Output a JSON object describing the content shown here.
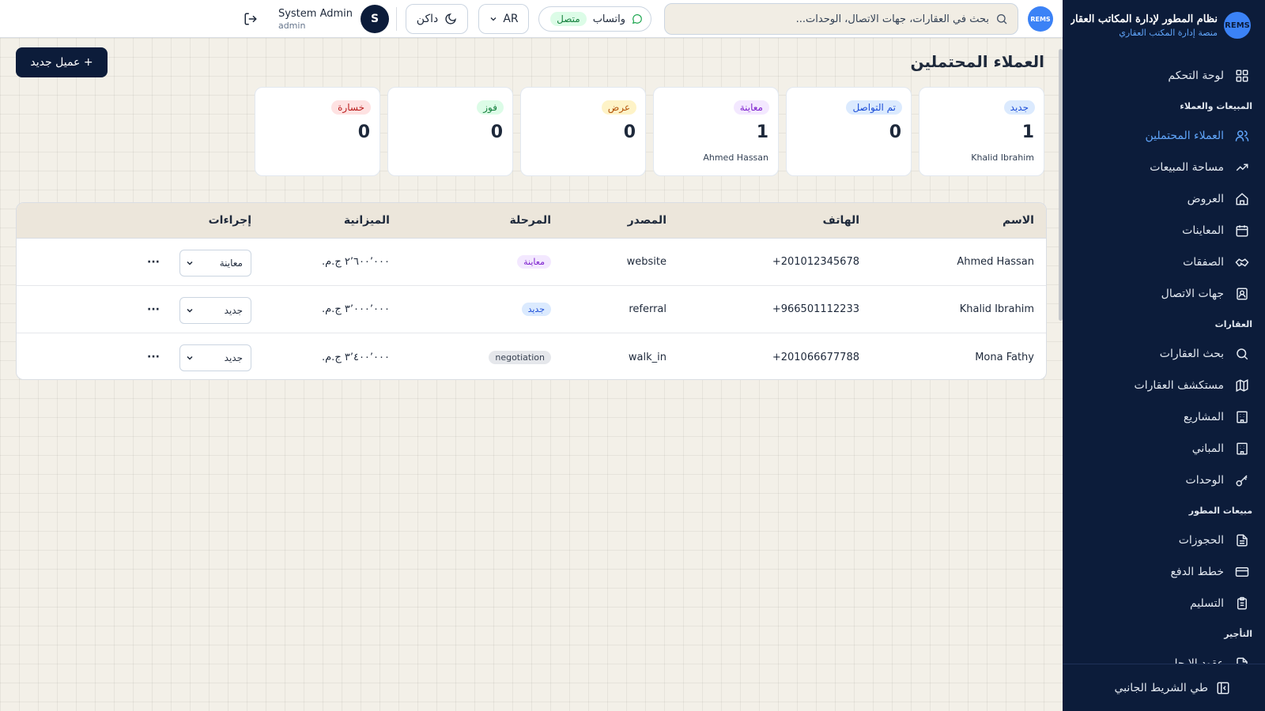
{
  "brand": {
    "logo_text": "REMS",
    "title": "نظام المطور لإدارة المكاتب العقارية",
    "subtitle": "منصة إدارة المكتب العقاري"
  },
  "sidebar": {
    "dashboard": "لوحة التحكم",
    "section_sales": "المبيعات والعملاء",
    "leads": "العملاء المحتملين",
    "sales_space": "مساحة المبيعات",
    "offers": "العروض",
    "viewings": "المعاينات",
    "deals": "الصفقات",
    "contacts": "جهات الاتصال",
    "section_properties": "العقارات",
    "property_search": "بحث العقارات",
    "property_explorer": "مستكشف العقارات",
    "projects": "المشاريع",
    "buildings": "المباني",
    "units": "الوحدات",
    "section_developer": "مبيعات المطور",
    "bookings": "الحجوزات",
    "payment_plans": "خطط الدفع",
    "handover": "التسليم",
    "section_rental": "التأجير",
    "leases": "عقود الإيجار",
    "collapse": "طي الشريط الجانبي"
  },
  "topbar": {
    "avatar_text": "REMS",
    "search_placeholder": "بحث في العقارات، جهات الاتصال، الوحدات...",
    "whatsapp_label": "واتساب",
    "whatsapp_status": "متصل",
    "language": "AR",
    "theme": "داكن",
    "user_initial": "S",
    "user_name": "System Admin",
    "user_role": "admin"
  },
  "page": {
    "title": "العملاء المحتملين",
    "add_button": "+ عميل جديد"
  },
  "colors": {
    "sidebar_bg": "#0c1c3a",
    "accent": "#3b82f6",
    "primary_button": "#0c1c3a"
  },
  "stages": [
    {
      "label": "جديد",
      "count": "1",
      "names": "Khalid Ibrahim",
      "bg": "#dbeafe",
      "fg": "#1d4ed8"
    },
    {
      "label": "تم التواصل",
      "count": "0",
      "names": "",
      "bg": "#dbeafe",
      "fg": "#1d4ed8"
    },
    {
      "label": "معاينة",
      "count": "1",
      "names": "Ahmed Hassan",
      "bg": "#f3e8ff",
      "fg": "#7e22ce"
    },
    {
      "label": "عرض",
      "count": "0",
      "names": "",
      "bg": "#fef3c7",
      "fg": "#b45309"
    },
    {
      "label": "فوز",
      "count": "0",
      "names": "",
      "bg": "#dcfce7",
      "fg": "#15803d"
    },
    {
      "label": "خسارة",
      "count": "0",
      "names": "",
      "bg": "#fee2e2",
      "fg": "#b91c1c"
    }
  ],
  "table": {
    "headers": {
      "name": "الاسم",
      "phone": "الهاتف",
      "source": "المصدر",
      "stage": "المرحلة",
      "budget": "الميزانية",
      "actions": "إجراءات"
    },
    "rows": [
      {
        "name": "Ahmed Hassan",
        "phone": "+201012345678",
        "source": "website",
        "stage": "معاينة",
        "stage_bg": "#f3e8ff",
        "stage_fg": "#7e22ce",
        "budget": "٢٬٦٠٠٬٠٠٠ ج.م.",
        "select": "معاينة",
        "more": "···"
      },
      {
        "name": "Khalid Ibrahim",
        "phone": "+966501112233",
        "source": "referral",
        "stage": "جديد",
        "stage_bg": "#dbeafe",
        "stage_fg": "#1d4ed8",
        "budget": "٣٬٠٠٠٬٠٠٠ ج.م.",
        "select": "جديد",
        "more": "···"
      },
      {
        "name": "Mona Fathy",
        "phone": "+201066677788",
        "source": "walk_in",
        "stage": "negotiation",
        "stage_bg": "#e5e7eb",
        "stage_fg": "#374151",
        "budget": "٣٬٤٠٠٬٠٠٠ ج.م.",
        "select": "جديد",
        "more": "···"
      }
    ]
  }
}
